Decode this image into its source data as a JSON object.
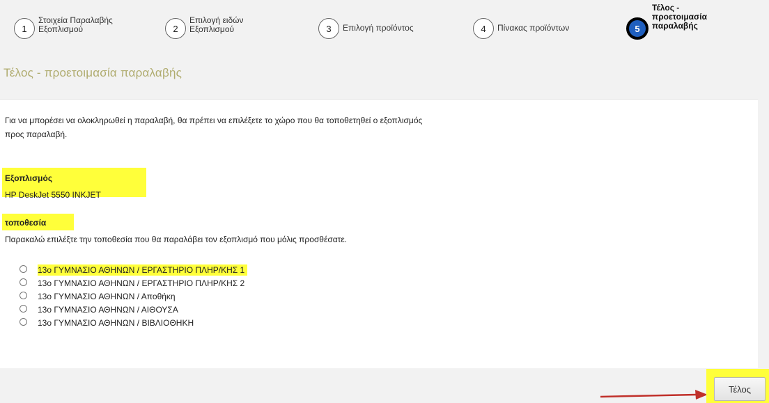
{
  "wizard": {
    "steps": [
      {
        "number": "1",
        "label": "Στοιχεία Παραλαβής Εξοπλισμού"
      },
      {
        "number": "2",
        "label": "Επιλογή ειδών Εξοπλισμού"
      },
      {
        "number": "3",
        "label": "Επιλογή προϊόντος"
      },
      {
        "number": "4",
        "label": "Πίνακας προϊόντων"
      },
      {
        "number": "5",
        "label": "Τέλος - προετοιμασία παραλαβής"
      }
    ]
  },
  "page": {
    "heading": "Τέλος - προετοιμασία παραλαβής",
    "intro": "Για να μπορέσει να ολοκληρωθεί η παραλαβή, θα πρέπει να επιλέξετε το χώρο που θα τοποθετηθεί ο εξοπλισμός προς παραλαβή."
  },
  "equipment": {
    "title": "Εξοπλισμός",
    "value": "HP DeskJet 5550 INKJET"
  },
  "location": {
    "title": "τοποθεσία",
    "help": "Παρακαλώ επιλέξτε την τοποθεσία που θα παραλάβει τον εξοπλισμό που μόλις προσθέσατε.",
    "options": [
      "13ο ΓΥΜΝΑΣΙΟ ΑΘΗΝΩΝ / ΕΡΓΑΣΤΗΡΙΟ ΠΛΗΡ/ΚΗΣ 1",
      "13ο ΓΥΜΝΑΣΙΟ ΑΘΗΝΩΝ / ΕΡΓΑΣΤΗΡΙΟ ΠΛΗΡ/ΚΗΣ 2",
      "13ο ΓΥΜΝΑΣΙΟ ΑΘΗΝΩΝ / Αποθήκη",
      "13ο ΓΥΜΝΑΣΙΟ ΑΘΗΝΩΝ / ΑΙΘΟΥΣΑ",
      "13ο ΓΥΜΝΑΣΙΟ ΑΘΗΝΩΝ / ΒΙΒΛΙΟΘΗΚΗ"
    ]
  },
  "footer": {
    "finish_label": "Τέλος"
  },
  "colors": {
    "highlight": "#ffff3a",
    "heading": "#b0ac6f",
    "active_step": "#1f5fbf",
    "arrow": "#c0302a"
  }
}
